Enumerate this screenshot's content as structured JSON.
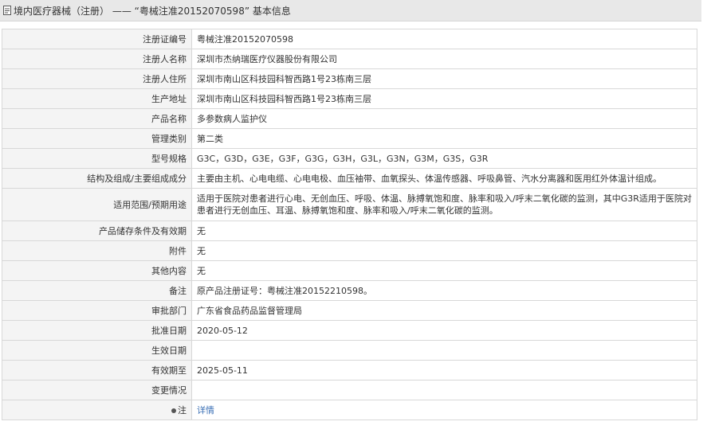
{
  "header": {
    "title": "境内医疗器械（注册） —— “粤械注准20152070598” 基本信息"
  },
  "rows": [
    {
      "label": "注册证编号",
      "value": "粤械注准20152070598"
    },
    {
      "label": "注册人名称",
      "value": "深圳市杰纳瑞医疗仪器股份有限公司"
    },
    {
      "label": "注册人住所",
      "value": "深圳市南山区科技园科智西路1号23栋南三层"
    },
    {
      "label": "生产地址",
      "value": "深圳市南山区科技园科智西路1号23栋南三层"
    },
    {
      "label": "产品名称",
      "value": "多参数病人监护仪"
    },
    {
      "label": "管理类别",
      "value": "第二类"
    },
    {
      "label": "型号规格",
      "value": "G3C，G3D，G3E，G3F，G3G，G3H，G3L，G3N，G3M，G3S，G3R"
    },
    {
      "label": "结构及组成/主要组成成分",
      "value": "主要由主机、心电电缆、心电电极、血压袖带、血氧探头、体温传感器、呼吸鼻管、汽水分离器和医用红外体温计组成。"
    },
    {
      "label": "适用范围/预期用途",
      "value": "适用于医院对患者进行心电、无创血压、呼吸、体温、脉搏氧饱和度、脉率和吸入/呼末二氧化碳的监测，其中G3R适用于医院对患者进行无创血压、耳温、脉搏氧饱和度、脉率和吸入/呼末二氧化碳的监测。"
    },
    {
      "label": "产品储存条件及有效期",
      "value": "无"
    },
    {
      "label": "附件",
      "value": "无"
    },
    {
      "label": "其他内容",
      "value": "无"
    },
    {
      "label": "备注",
      "value": "原产品注册证号：粤械注准20152210598。"
    },
    {
      "label": "审批部门",
      "value": "广东省食品药品监督管理局"
    },
    {
      "label": "批准日期",
      "value": "2020-05-12"
    },
    {
      "label": "生效日期",
      "value": ""
    },
    {
      "label": "有效期至",
      "value": "2025-05-11"
    },
    {
      "label": "变更情况",
      "value": ""
    },
    {
      "label": "注",
      "value": "详情"
    }
  ]
}
